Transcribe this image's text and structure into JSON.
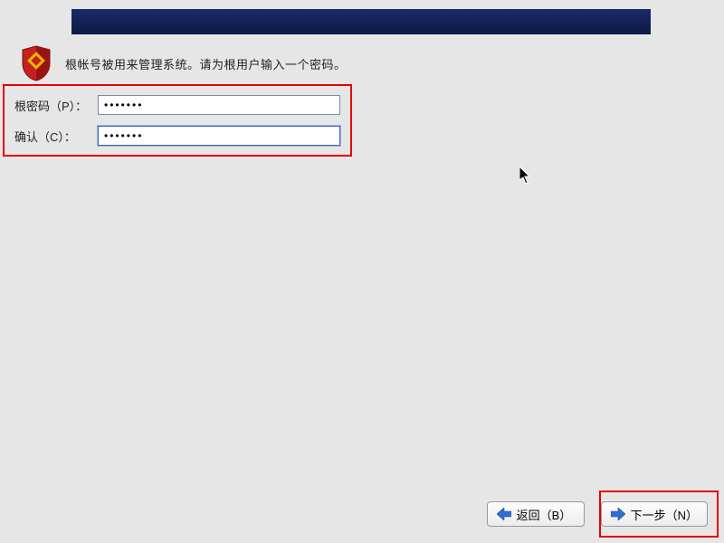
{
  "intro_text": "根帐号被用来管理系统。请为根用户输入一个密码。",
  "form": {
    "password_label": "根密码（P）：",
    "password_value": "•••••••",
    "confirm_label": "确认（C）：",
    "confirm_value": "•••••••"
  },
  "buttons": {
    "back": "返回（B）",
    "next": "下一步（N）"
  },
  "icons": {
    "shield": "shield-icon",
    "arrow_left": "arrow-left-icon",
    "arrow_right": "arrow-right-icon"
  },
  "colors": {
    "banner_top": "#192a6a",
    "banner_bottom": "#0c1a44",
    "highlight": "#e60000",
    "arrow_fill": "#2f6fd0"
  }
}
